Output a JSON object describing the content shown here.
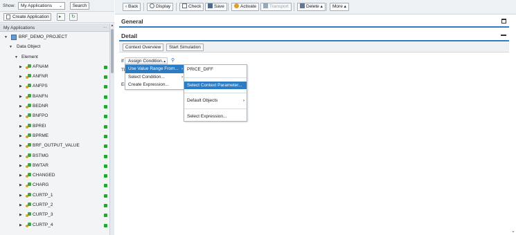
{
  "left": {
    "show_label": "Show:",
    "show_select_value": "My Applications",
    "search_label": "Search",
    "create_app_label": "Create Application",
    "my_apps_header": "My Applications",
    "header_dots": "...",
    "tree": {
      "project": "BRF_DEMO_PROJECT",
      "data_object": "Data Object",
      "element": "Element",
      "elements": [
        "AFNAM",
        "ANFNR",
        "ANFPS",
        "BANFN",
        "BEDNR",
        "BNFPO",
        "BPREI",
        "BPRME",
        "BRF_OUTPUT_VALUE",
        "BSTMG",
        "BWTAR",
        "CHANGED",
        "CHARG",
        "CURTP_1",
        "CURTP_2",
        "CURTP_3",
        "CURTP_4"
      ],
      "status_color": "#1fa82e"
    }
  },
  "toolbar": {
    "back": "Back",
    "display": "Display",
    "check": "Check",
    "save": "Save",
    "activate": "Activate",
    "transport": "Transport",
    "delete": "Delete",
    "more": "More"
  },
  "sections": {
    "general": "General",
    "detail": "Detail",
    "context_overview": "Context Overview",
    "start_simulation": "Start Simulation"
  },
  "row_labels": {
    "r1": "If",
    "r2": "Th",
    "r3": "Ei"
  },
  "assign": {
    "label": "Assign Condition..."
  },
  "menu1": {
    "items": [
      "Use Value Range From...",
      "Select Condition...",
      "Create Expression..."
    ]
  },
  "menu2": {
    "items": [
      "PRICE_DIFF",
      "Select Context Parameter...",
      "Default Objects",
      "Select Expression..."
    ]
  },
  "accent_color": "#2a7cc7"
}
